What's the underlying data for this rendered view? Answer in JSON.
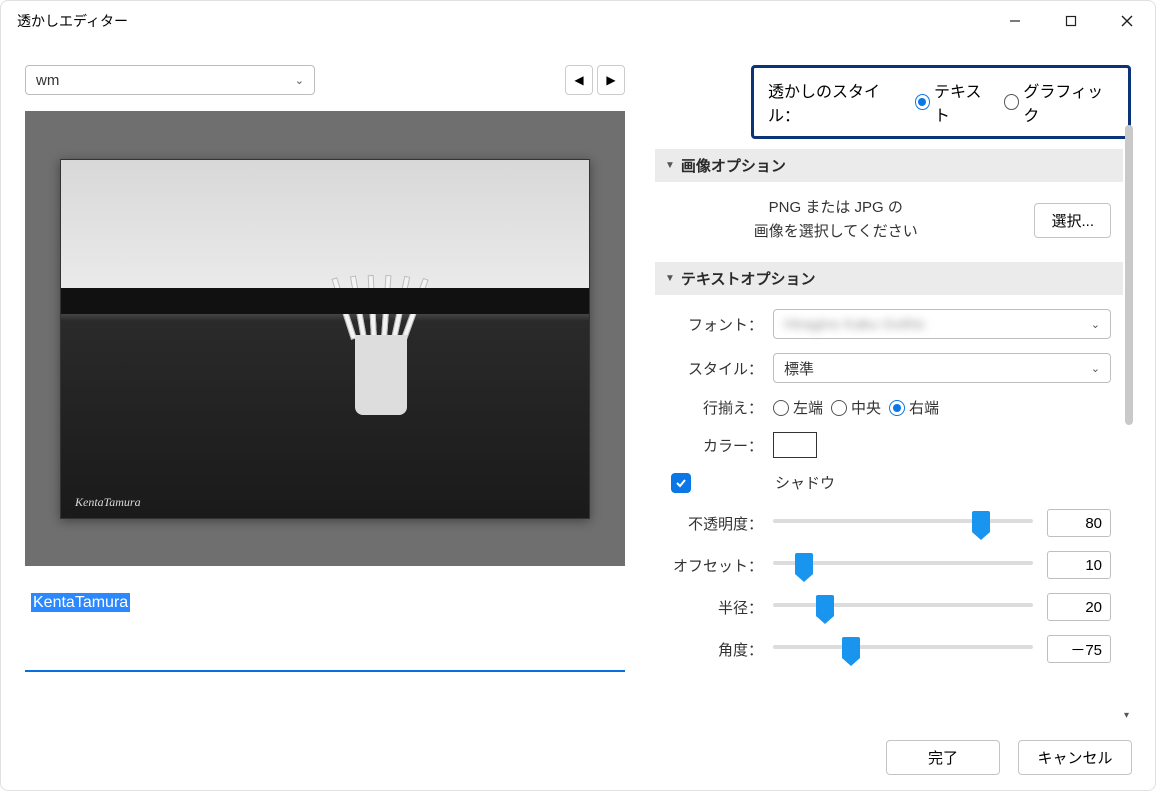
{
  "window": {
    "title": "透かしエディター"
  },
  "preset": {
    "value": "wm"
  },
  "watermark_text": "KentaTamura",
  "preview_signature": "KentaTamura",
  "style": {
    "label": "透かしのスタイル：",
    "text": "テキスト",
    "graphic": "グラフィック",
    "selected": "text"
  },
  "image_options": {
    "header": "画像オプション",
    "message_line1": "PNG または JPG の",
    "message_line2": "画像を選択してください",
    "choose": "選択..."
  },
  "text_options": {
    "header": "テキストオプション",
    "font_label": "フォント：",
    "font_value": "",
    "style_label": "スタイル：",
    "style_value": "標準",
    "align_label": "行揃え：",
    "align_left": "左端",
    "align_center": "中央",
    "align_right": "右端",
    "align_selected": "right",
    "color_label": "カラー：",
    "shadow_label": "シャドウ",
    "shadow_checked": true,
    "opacity_label": "不透明度：",
    "opacity_value": 80,
    "offset_label": "オフセット：",
    "offset_value": 10,
    "radius_label": "半径：",
    "radius_value": 20,
    "angle_label": "角度：",
    "angle_value": "－75"
  },
  "footer": {
    "done": "完了",
    "cancel": "キャンセル"
  }
}
